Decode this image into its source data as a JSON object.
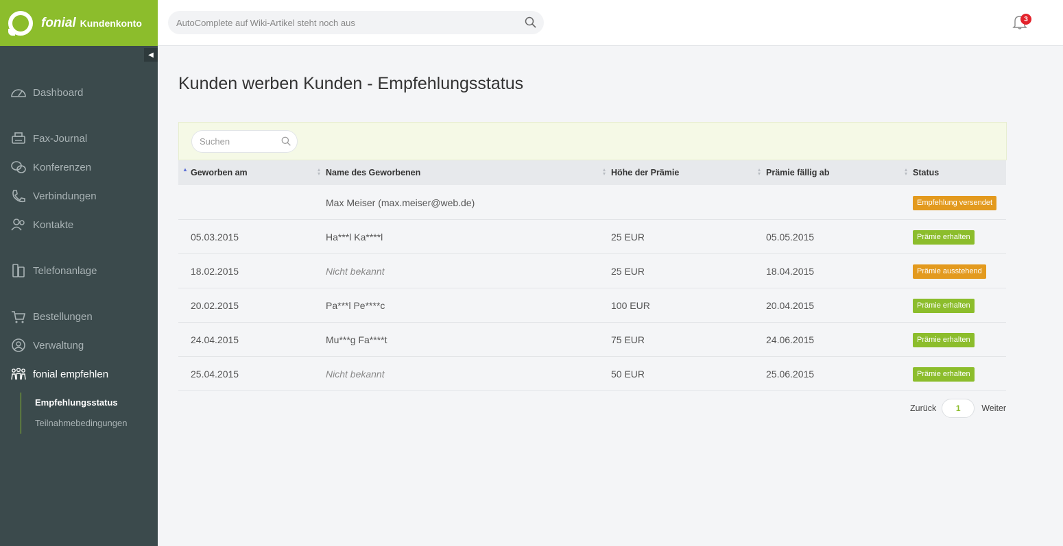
{
  "brand": {
    "name": "fonial",
    "subtitle": "Kundenkonto",
    "color": "#8cbd2c"
  },
  "topbar": {
    "search_placeholder": "AutoComplete auf Wiki-Artikel steht noch aus",
    "notification_count": "3"
  },
  "sidebar": {
    "items": [
      {
        "label": "Dashboard",
        "icon": "dashboard-icon"
      },
      {
        "label": "Fax-Journal",
        "icon": "fax-icon"
      },
      {
        "label": "Konferenzen",
        "icon": "conference-icon"
      },
      {
        "label": "Verbindungen",
        "icon": "phone-icon"
      },
      {
        "label": "Kontakte",
        "icon": "contacts-icon"
      },
      {
        "label": "Telefonanlage",
        "icon": "phone-system-icon"
      },
      {
        "label": "Bestellungen",
        "icon": "cart-icon"
      },
      {
        "label": "Verwaltung",
        "icon": "user-circle-icon"
      },
      {
        "label": "fonial empfehlen",
        "icon": "people-icon"
      }
    ],
    "subitems": [
      {
        "label": "Empfehlungsstatus"
      },
      {
        "label": "Teilnahmebedingungen"
      }
    ]
  },
  "main": {
    "title": "Kunden werben Kunden - Empfehlungsstatus",
    "search_placeholder": "Suchen",
    "columns": [
      "Geworben am",
      "Name des Geworbenen",
      "Höhe der Prämie",
      "Prämie fällig ab",
      "Status"
    ],
    "rows": [
      {
        "date": "",
        "name": "Max Meiser (max.meiser@web.de)",
        "name_muted": false,
        "amount": "",
        "due": "",
        "status": "Empfehlung versendet",
        "status_color": "#e39a1e"
      },
      {
        "date": "05.03.2015",
        "name": "Ha***l Ka****l",
        "name_muted": false,
        "amount": "25 EUR",
        "due": "05.05.2015",
        "status": "Prämie erhalten",
        "status_color": "#8cbd2c"
      },
      {
        "date": "18.02.2015",
        "name": "Nicht bekannt",
        "name_muted": true,
        "amount": "25 EUR",
        "due": "18.04.2015",
        "status": "Prämie ausstehend",
        "status_color": "#e39a1e"
      },
      {
        "date": "20.02.2015",
        "name": "Pa***l Pe****c",
        "name_muted": false,
        "amount": "100 EUR",
        "due": "20.04.2015",
        "status": "Prämie erhalten",
        "status_color": "#8cbd2c"
      },
      {
        "date": "24.04.2015",
        "name": "Mu***g Fa****t",
        "name_muted": false,
        "amount": "75 EUR",
        "due": "24.06.2015",
        "status": "Prämie erhalten",
        "status_color": "#8cbd2c"
      },
      {
        "date": "25.04.2015",
        "name": "Nicht bekannt",
        "name_muted": true,
        "amount": "50 EUR",
        "due": "25.06.2015",
        "status": "Prämie erhalten",
        "status_color": "#8cbd2c"
      }
    ],
    "pagination": {
      "prev": "Zurück",
      "page": "1",
      "next": "Weiter"
    }
  }
}
